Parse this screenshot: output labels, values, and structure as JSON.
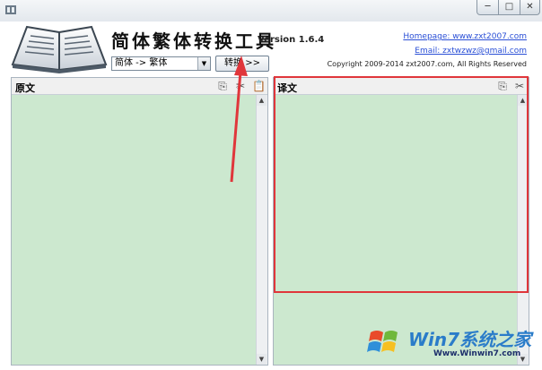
{
  "window": {
    "minimize_glyph": "─",
    "maximize_glyph": "□",
    "close_glyph": "✕"
  },
  "header": {
    "title": "简体繁体转换工具",
    "version": "Version 1.6.4",
    "homepage": "Homepage: www.zxt2007.com",
    "email": "Email: zxtwzwz@gmail.com",
    "copyright": "Copyright 2009-2014 zxt2007.com, All Rights Reserved",
    "mode_select": {
      "value": "简体 -> 繁体"
    },
    "convert_button": "转换 >>"
  },
  "panels": {
    "source": {
      "label": "原文",
      "tools": [
        "copy-icon",
        "cut-icon",
        "paste-icon"
      ]
    },
    "target": {
      "label": "译文",
      "tools": [
        "copy-icon",
        "cut-icon"
      ]
    }
  },
  "watermark": {
    "brand": "Win7系统之家",
    "url": "Www.Winwin7.com"
  },
  "colors": {
    "text_area": "#cce8cf",
    "annotation_red": "#e0363b",
    "link": "#2a4fd6"
  }
}
